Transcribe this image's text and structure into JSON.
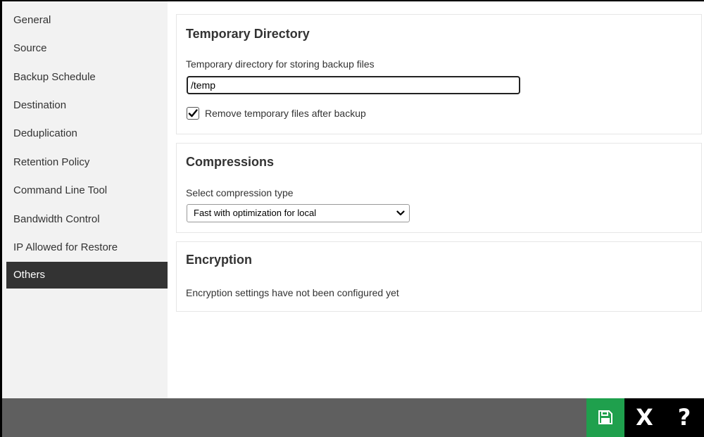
{
  "sidebar": {
    "items": [
      {
        "label": "General"
      },
      {
        "label": "Source"
      },
      {
        "label": "Backup Schedule"
      },
      {
        "label": "Destination"
      },
      {
        "label": "Deduplication"
      },
      {
        "label": "Retention Policy"
      },
      {
        "label": "Command Line Tool"
      },
      {
        "label": "Bandwidth Control"
      },
      {
        "label": "IP Allowed for Restore"
      },
      {
        "label": "Others"
      }
    ],
    "active": "Others"
  },
  "temporary_directory": {
    "title": "Temporary Directory",
    "field_label": "Temporary directory for storing backup files",
    "value": "/temp",
    "remove_checkbox_label": "Remove temporary files after backup",
    "remove_checked": true
  },
  "compressions": {
    "title": "Compressions",
    "field_label": "Select compression type",
    "selected": "Fast with optimization for local"
  },
  "encryption": {
    "title": "Encryption",
    "message": "Encryption settings have not been configured yet"
  },
  "footer": {
    "save_icon": "floppy-disk-icon",
    "close_glyph": "X",
    "help_glyph": "?"
  },
  "colors": {
    "sidebar_bg": "#f2f2f2",
    "active_item_bg": "#333333",
    "footer_bg": "#5f5f5f",
    "save_button": "#1fa04d"
  }
}
